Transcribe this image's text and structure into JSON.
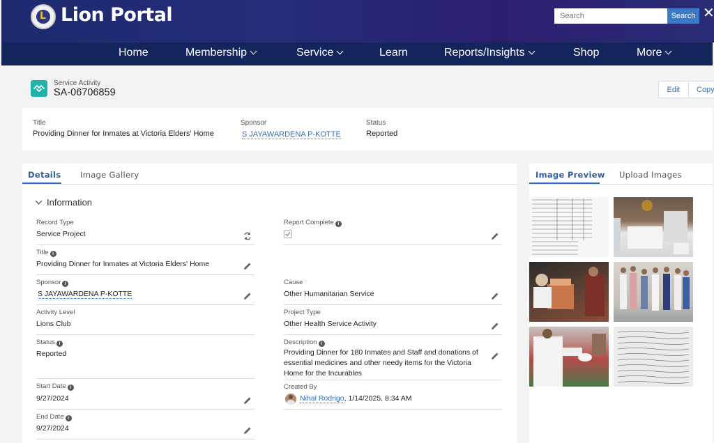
{
  "header": {
    "brand": "Lion Portal",
    "search_placeholder": "Search",
    "search_button": "Search",
    "close_glyph": "✕"
  },
  "nav": [
    {
      "label": "Home",
      "dropdown": false
    },
    {
      "label": "Membership",
      "dropdown": true
    },
    {
      "label": "Service",
      "dropdown": true
    },
    {
      "label": "Learn",
      "dropdown": false
    },
    {
      "label": "Reports/Insights",
      "dropdown": true
    },
    {
      "label": "Shop",
      "dropdown": false
    },
    {
      "label": "More",
      "dropdown": true
    }
  ],
  "record": {
    "object_type": "Service Activity",
    "id": "SA-06706859",
    "icon": "handshake-icon",
    "icon_color": "#1fb3ab",
    "actions": {
      "edit": "Edit",
      "copy": "Copy"
    }
  },
  "highlights": {
    "title_label": "Title",
    "title_value": "Providing Dinner for Inmates at Victoria Elders' Home",
    "sponsor_label": "Sponsor",
    "sponsor_value": "S JAYAWARDENA P-KOTTE",
    "status_label": "Status",
    "status_value": "Reported"
  },
  "tabs": {
    "details": "Details",
    "gallery": "Image Gallery"
  },
  "section": "Information",
  "fields": {
    "record_type": {
      "label": "Record Type",
      "value": "Service Project"
    },
    "report_complete": {
      "label": "Report Complete",
      "checked": true
    },
    "title": {
      "label": "Title",
      "value": "Providing Dinner for Inmates at Victoria Elders' Home"
    },
    "sponsor": {
      "label": "Sponsor",
      "value": "S JAYAWARDENA P-KOTTE"
    },
    "cause": {
      "label": "Cause",
      "value": "Other Humanitarian Service"
    },
    "activity_level": {
      "label": "Activity Level",
      "value": "Lions Club"
    },
    "project_type": {
      "label": "Project Type",
      "value": "Other Health Service Activity"
    },
    "status": {
      "label": "Status",
      "value": "Reported"
    },
    "description": {
      "label": "Description",
      "value": "Providing Dinner for 180 Inmates and Staff and donations of essential medicines and other needy items for the Victoria Home for the Incurables"
    },
    "start_date": {
      "label": "Start Date",
      "value": "9/27/2024"
    },
    "created_by": {
      "label": "Created By",
      "user": "Nihal Rodrigo",
      "timestamp": ", 1/14/2025, 8:34 AM"
    },
    "end_date": {
      "label": "End Date",
      "value": "9/27/2024"
    }
  },
  "side_tabs": {
    "preview": "Image Preview",
    "upload": "Upload Images"
  },
  "colors": {
    "nav_bg": "#13255a",
    "link": "#2f6fbe",
    "accent": "#3b79c9"
  }
}
